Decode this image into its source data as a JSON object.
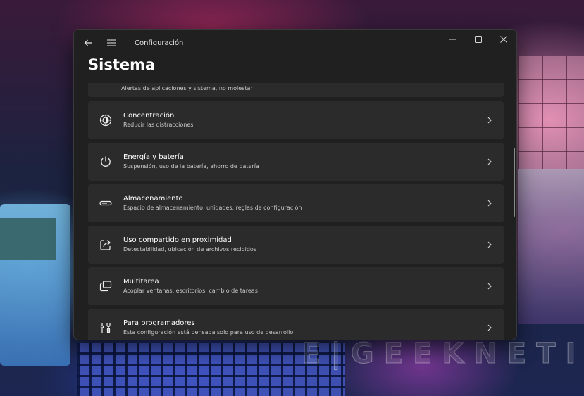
{
  "window": {
    "app_title": "Configuración",
    "page_title": "Sistema"
  },
  "partial_item": {
    "subtitle": "Alertas de aplicaciones y sistema, no molestar"
  },
  "items": [
    {
      "label": "Concentración",
      "subtitle": "Reducir las distracciones",
      "icon": "focus-icon"
    },
    {
      "label": "Energía y batería",
      "subtitle": "Suspensión, uso de la batería, ahorro de batería",
      "icon": "power-icon"
    },
    {
      "label": "Almacenamiento",
      "subtitle": "Espacio de almacenamiento, unidades, reglas de configuración",
      "icon": "storage-icon"
    },
    {
      "label": "Uso compartido en proximidad",
      "subtitle": "Detectabilidad, ubicación de archivos recibidos",
      "icon": "share-icon"
    },
    {
      "label": "Multitarea",
      "subtitle": "Acoplar ventanas, escritorios, cambio de tareas",
      "icon": "multitask-icon"
    },
    {
      "label": "Para programadores",
      "subtitle": "Esta configuración está pensada solo para uso de desarrollo",
      "icon": "developer-tools-icon"
    }
  ],
  "watermark": "E|GEEKNETIC"
}
